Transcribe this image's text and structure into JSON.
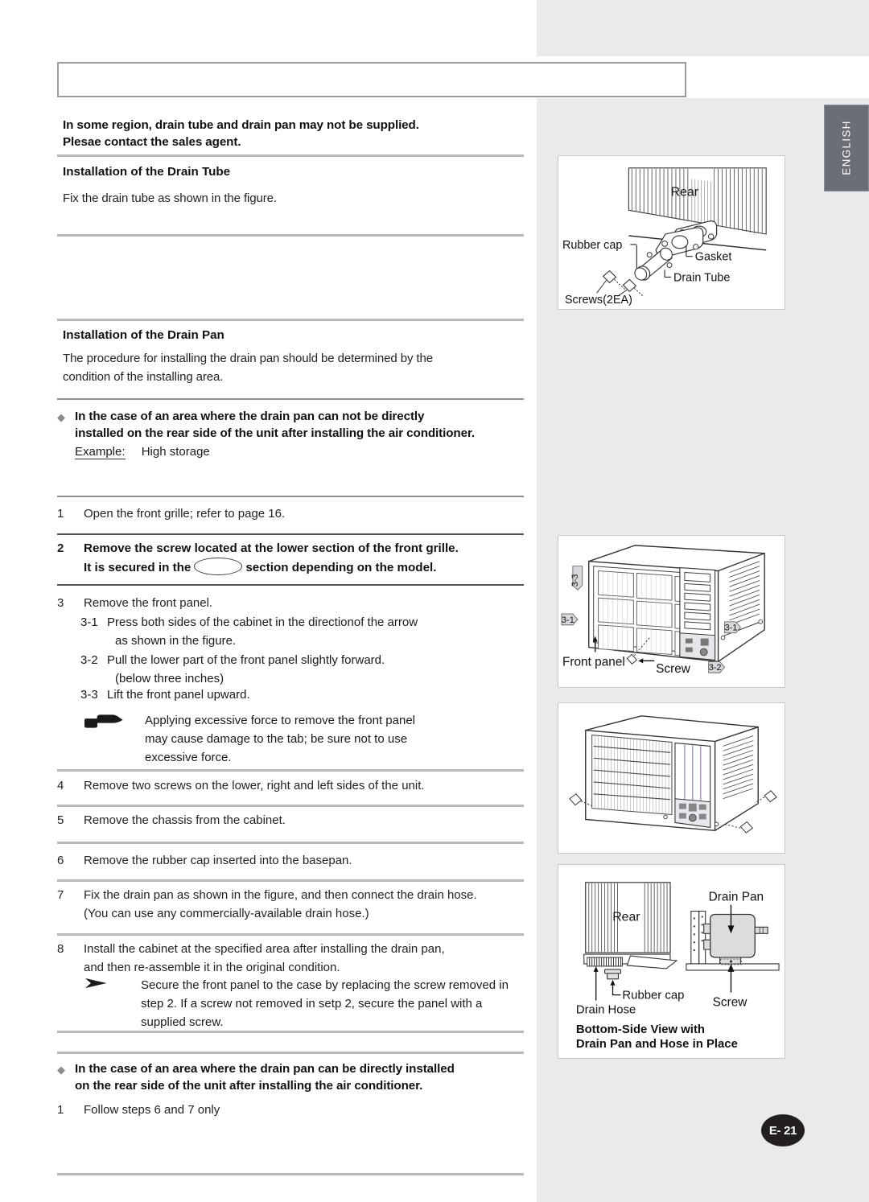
{
  "page": {
    "language_tab": "ENGLISH",
    "page_number": "E- 21",
    "header_box_text": ""
  },
  "notice": {
    "line1": "In some region, drain tube and drain pan may not be supplied.",
    "line2": "Plesae contact the sales agent."
  },
  "drain_tube_section": {
    "heading": "Installation of the Drain Tube",
    "body": "Fix the drain tube as shown in the figure."
  },
  "drain_pan_section": {
    "heading": "Installation of the Drain Pan",
    "body_line1": "The procedure for installing the drain pan should be determined by the",
    "body_line2": "condition of the installing area."
  },
  "case_not_direct": {
    "bullet_icon": "diamond-bullet",
    "line1": "In the case of an area where the drain pan can not be directly",
    "line2": "installed on the rear side of the unit after installing the air conditioner.",
    "example_label": "Example:",
    "example_value": "High storage"
  },
  "steps": {
    "s1": {
      "num": "1",
      "text": "Open the front grille; refer to page 16."
    },
    "s2": {
      "num": "2",
      "line1": "Remove the screw located at the lower section of the front grille.",
      "line2_pre": "It is secured in the",
      "line2_post": "section depending on the model."
    },
    "s3": {
      "num": "3",
      "text": "Remove the front panel.",
      "sub": [
        {
          "num": "3-1",
          "line1": "Press both sides of the cabinet in the directionof the arrow",
          "line2": "as shown in the figure."
        },
        {
          "num": "3-2",
          "line1": "Pull the lower part of the front panel slightly forward.",
          "line2": "(below three inches)"
        },
        {
          "num": "3-3",
          "line1": "Lift the front panel upward.",
          "line2": ""
        }
      ],
      "note_icon": "pointing-hand-icon",
      "note_line1": "Applying excessive force to remove the front panel",
      "note_line2": "may cause damage to the tab; be sure not to use",
      "note_line3": "excessive force."
    },
    "s4": {
      "num": "4",
      "text": "Remove two screws on the lower, right and left sides of the unit."
    },
    "s5": {
      "num": "5",
      "text": "Remove the chassis from the cabinet."
    },
    "s6": {
      "num": "6",
      "text": "Remove the rubber cap inserted into the basepan."
    },
    "s7": {
      "num": "7",
      "line1": "Fix the drain pan as shown in the figure, and then connect the drain hose.",
      "line2": "(You can use any commercially-available drain hose.)"
    },
    "s8": {
      "num": "8",
      "line1": "Install the cabinet at the specified area after installing the drain pan,",
      "line2": "and then re-assemble it in the original condition.",
      "note_icon": "arrowhead-bullet",
      "note_line1": "Secure the front panel to the case by replacing the screw removed in",
      "note_line2": "step 2. If a screw not removed in setp 2, secure the panel with a",
      "note_line3": "supplied screw."
    }
  },
  "case_direct": {
    "bullet_icon": "diamond-bullet",
    "line1": "In the case of an area where the drain pan can be directly installed",
    "line2": "on the rear side of the unit after installing the air conditioner.",
    "step_num": "1",
    "step_text": "Follow steps 6 and 7 only"
  },
  "figures": {
    "fig1": {
      "name": "drain-tube-assembly-diagram",
      "labels": {
        "rear": "Rear",
        "rubber_cap": "Rubber cap",
        "gasket": "Gasket",
        "drain_tube": "Drain Tube",
        "screws": "Screws(2EA)"
      }
    },
    "fig2": {
      "name": "front-panel-removal-diagram",
      "labels": {
        "front_panel": "Front panel",
        "screw": "Screw",
        "m33": "3-3",
        "m31a": "3-1",
        "m31b": "3-1",
        "m32": "3-2"
      }
    },
    "fig3": {
      "name": "chassis-removal-diagram",
      "labels": {}
    },
    "fig4": {
      "name": "drain-pan-bottom-side-view-diagram",
      "labels": {
        "rear": "Rear",
        "drain_pan": "Drain Pan",
        "rubber_cap": "Rubber cap",
        "screw": "Screw",
        "drain_hose": "Drain Hose",
        "caption_line1": "Bottom-Side View with",
        "caption_line2": "Drain Pan and Hose in Place"
      }
    }
  },
  "colors": {
    "gray_band": "#e8eaeb",
    "divider": "#b9b9bd",
    "tab_bg": "#6b6e76",
    "badge_bg": "#231f20"
  }
}
